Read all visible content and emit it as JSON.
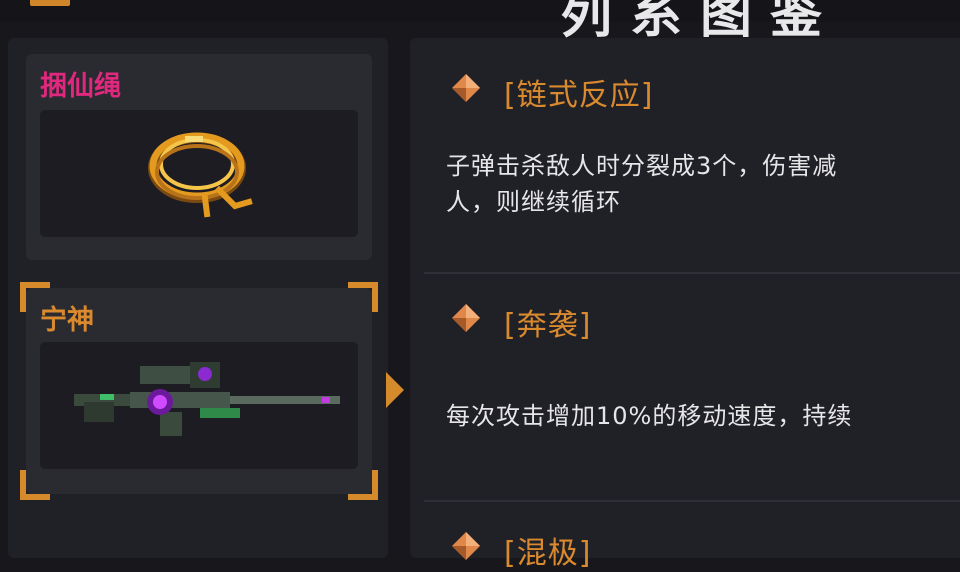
{
  "header": {
    "title": "列系图鉴"
  },
  "items": [
    {
      "name": "捆仙绳",
      "name_color": "#e0287e",
      "selected": false,
      "icon": "rope-icon"
    },
    {
      "name": "宁神",
      "name_color": "#d9892e",
      "selected": true,
      "icon": "sniper-rifle-icon"
    }
  ],
  "traits": [
    {
      "name": "[链式反应]",
      "desc_lines": [
        "子弹击杀敌人时分裂成3个，伤害减",
        "人，则继续循环"
      ]
    },
    {
      "name": "[奔袭]",
      "desc_lines": [
        "每次攻击增加10%的移动速度，持续"
      ]
    },
    {
      "name": "[混极]"
    }
  ],
  "colors": {
    "accent": "#d58a2c",
    "trait_name": "#d9892e",
    "text": "#e6e6e8",
    "panel": "#202027",
    "background": "#17171c"
  }
}
